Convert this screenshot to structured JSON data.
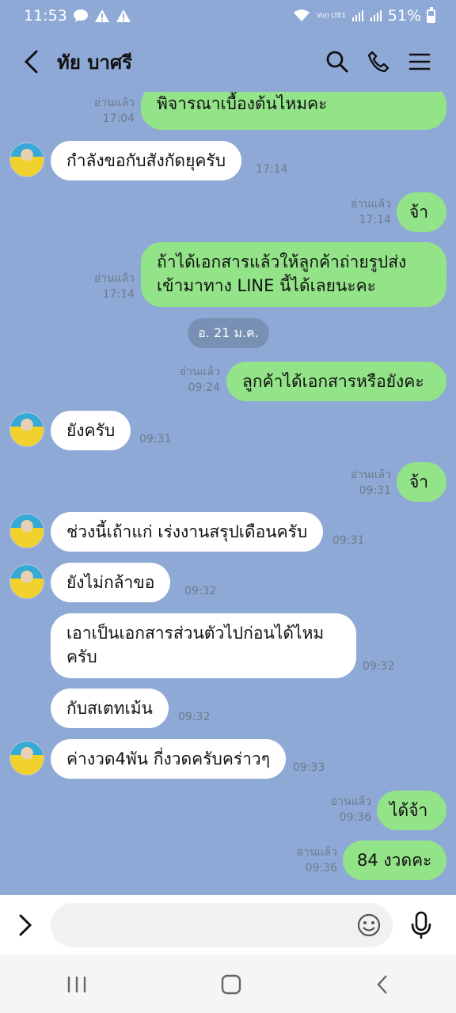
{
  "status": {
    "time": "11:53",
    "battery": "51%",
    "battery_fraction": 0.51,
    "lte": "Vo)) LTE1"
  },
  "header": {
    "title": "ทัย บาศรี"
  },
  "read_label": "อ่านแล้ว",
  "messages": [
    {
      "dir": "out",
      "text": "พิจารณาเบื้องต้นไหมคะ",
      "time": "17:04",
      "read": true
    },
    {
      "dir": "in",
      "text": "กำลังขอกับสังกัดยุครับ",
      "time": "17:14"
    },
    {
      "dir": "out",
      "text": "จ้า",
      "time": "17:14",
      "read": true
    },
    {
      "dir": "out",
      "text_lines": [
        "ถ้าได้เอกสารแล้วให้ลูกค้าถ่ายรูปส่ง",
        "เข้ามาทาง LINE นี้ได้เลยนะคะ"
      ],
      "time": "17:14",
      "read": true
    },
    {
      "dir": "date",
      "text": "อ. 21 ม.ค."
    },
    {
      "dir": "out",
      "text": "ลูกค้าได้เอกสารหรือยังคะ",
      "time": "09:24",
      "read": true
    },
    {
      "dir": "in",
      "text": "ยังครับ",
      "time": "09:31"
    },
    {
      "dir": "out",
      "text": "จ้า",
      "time": "09:31",
      "read": true
    },
    {
      "dir": "in",
      "text": "ช่วงนี้เถ้าแก่ เร่งงานสรุปเดือนครับ",
      "time": "09:31"
    },
    {
      "dir": "in",
      "text": "ยังไม่กล้าขอ",
      "time": "09:32"
    },
    {
      "dir": "in",
      "text_lines": [
        "เอาเป็นเอกสารส่วนตัวไปก่อนได้ไหม",
        "ครับ"
      ],
      "time": "09:32"
    },
    {
      "dir": "in",
      "text": "กับสเตทเม้น",
      "time": "09:32"
    },
    {
      "dir": "in",
      "text": "ค่างวด4พัน กี่งวดครับคร่าวๆ",
      "time": "09:33"
    },
    {
      "dir": "out",
      "text": "ได้จ้า",
      "time": "09:36",
      "read": true
    },
    {
      "dir": "out",
      "text": "84 งวดคะ",
      "time": "09:36",
      "read": true
    }
  ],
  "icons": {
    "back": "back-arrow-icon",
    "search": "search-icon",
    "call": "phone-icon",
    "menu": "menu-icon",
    "expand": "chevron-right-icon",
    "emoji": "emoji-icon",
    "mic": "microphone-icon"
  }
}
